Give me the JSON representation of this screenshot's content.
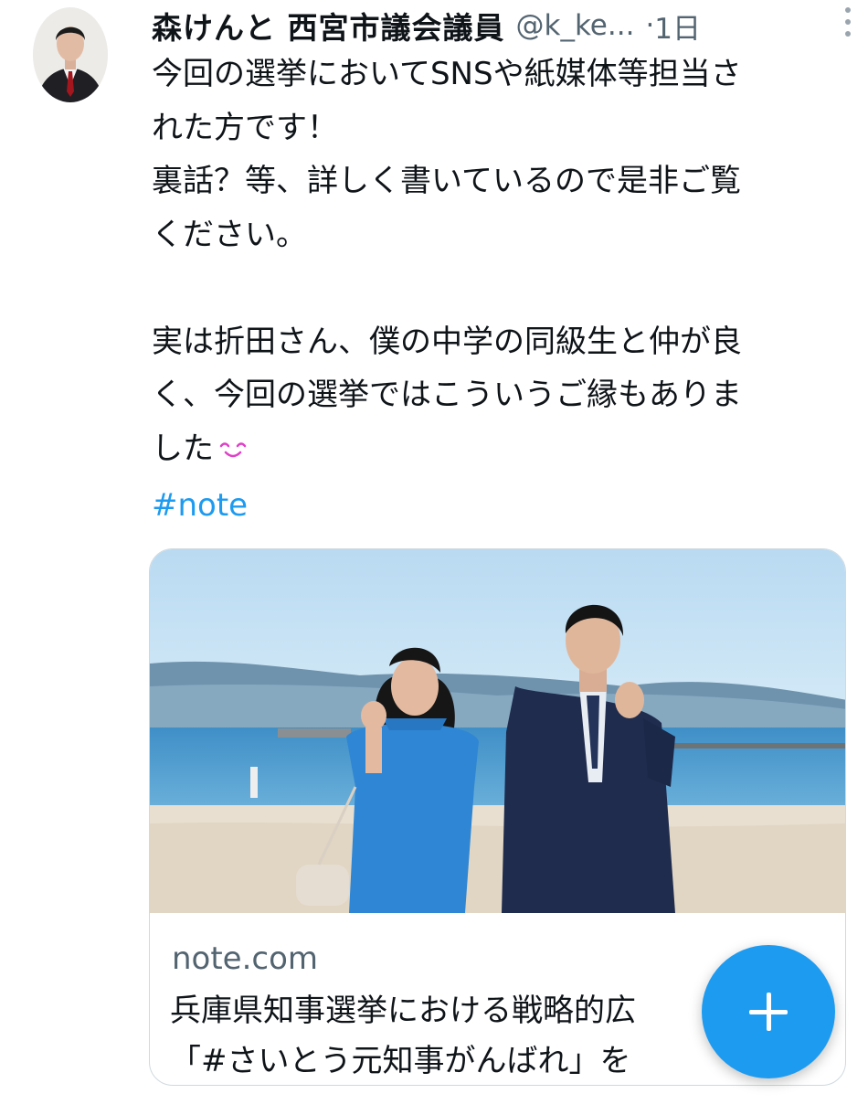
{
  "tweet": {
    "display_name": "森けんと 西宮市議会議員",
    "handle": "@k_ke...",
    "separator": "·",
    "time": "1日",
    "body_lines": [
      "今回の選挙においてSNSや紙媒体等担当さ",
      "れた方です！",
      "裏話？等、詳しく書いているので是非ご覧",
      "ください。",
      "",
      "実は折田さん、僕の中学の同級生と仲が良",
      "く、今回の選挙ではこういうご縁もありま",
      "した"
    ],
    "emoji": "smiling-face-emoji",
    "hashtag": "#note"
  },
  "card": {
    "domain": "note.com",
    "title_line_1": "兵庫県知事選挙における戦略的広",
    "title_line_2": "「#さいとう元知事がんばれ」を"
  },
  "fab": {
    "icon": "plus-icon"
  },
  "colors": {
    "accent": "#1d9bf0",
    "text": "#0f1419",
    "muted": "#536471",
    "border": "#cfd9de"
  }
}
